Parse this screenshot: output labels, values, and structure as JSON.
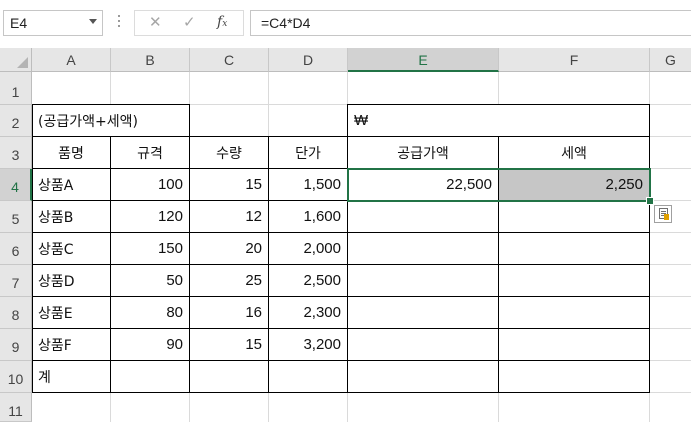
{
  "name_box": "E4",
  "formula": "=C4*D4",
  "formula_buttons": {
    "cancel": "✕",
    "enter": "✓",
    "fx": "fx"
  },
  "columns": [
    "A",
    "B",
    "C",
    "D",
    "E",
    "F",
    "G"
  ],
  "rows": [
    "1",
    "2",
    "3",
    "4",
    "5",
    "6",
    "7",
    "8",
    "9",
    "10",
    "11"
  ],
  "selected_cell": "E4",
  "accent_color": "#217346",
  "cells": {
    "A2": "(공급가액+세액)",
    "E2": "₩",
    "A3": "품명",
    "B3": "규격",
    "C3": "수량",
    "D3": "단가",
    "E3": "공급가액",
    "F3": "세액",
    "A4": "상품A",
    "B4": "100",
    "C4": "15",
    "D4": "1,500",
    "E4": "22,500",
    "F4": "2,250",
    "A5": "상품B",
    "B5": "120",
    "C5": "12",
    "D5": "1,600",
    "A6": "상품C",
    "B6": "150",
    "C6": "20",
    "D6": "2,000",
    "A7": "상품D",
    "B7": "50",
    "C7": "25",
    "D7": "2,500",
    "A8": "상품E",
    "B8": "80",
    "C8": "16",
    "D8": "2,300",
    "A9": "상품F",
    "B9": "90",
    "C9": "15",
    "D9": "3,200",
    "A10": "계"
  },
  "quick_analysis_icon": "quick-analysis-icon"
}
